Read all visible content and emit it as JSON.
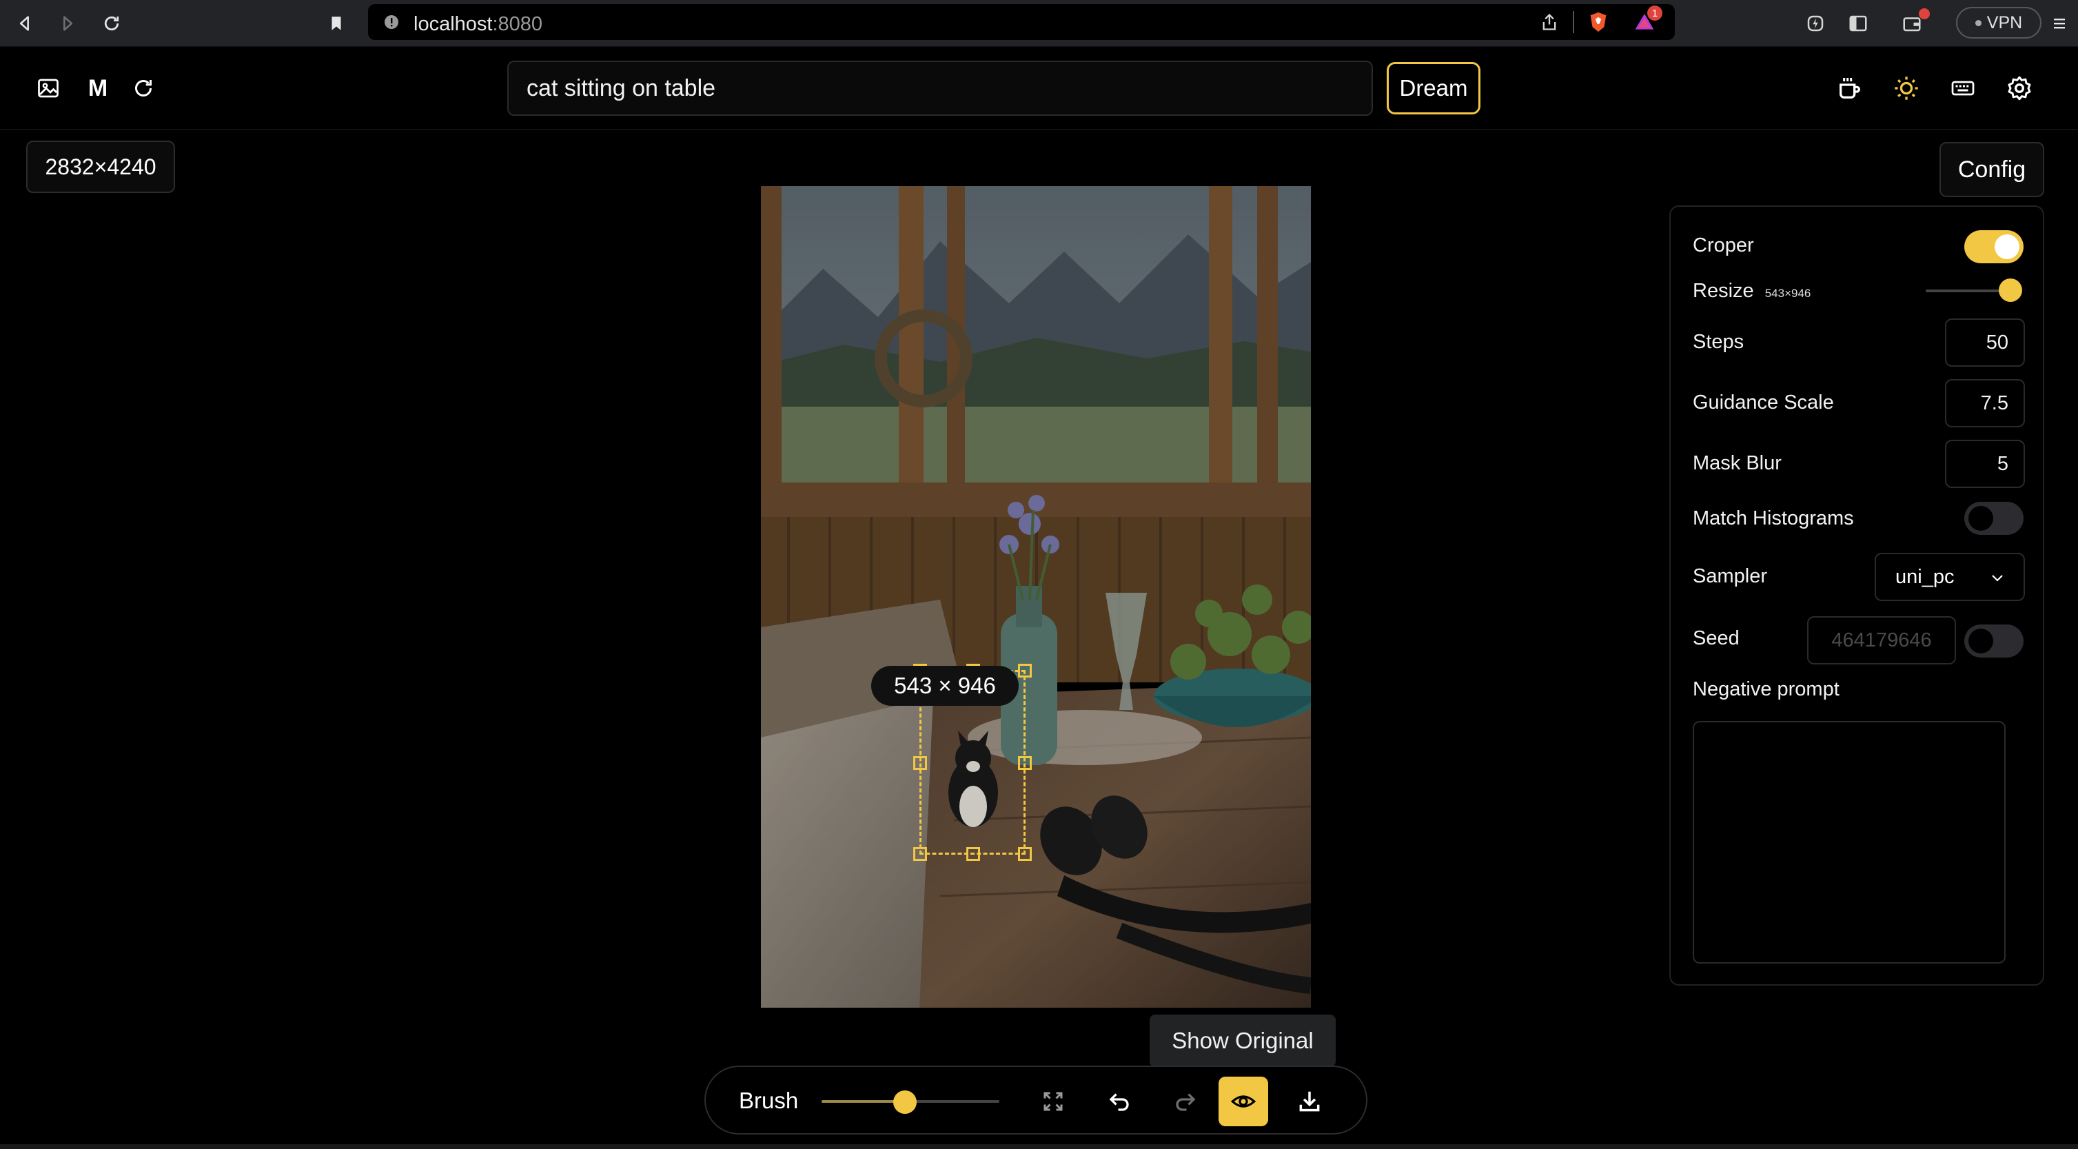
{
  "browser": {
    "url_host": "localhost",
    "url_port": ":8080",
    "vpn_label": "VPN",
    "brave_alert_count": "1"
  },
  "header": {
    "logo_text": "M",
    "prompt_value": "cat sitting on table",
    "dream_label": "Dream"
  },
  "canvas": {
    "image_dimensions": "2832×4240",
    "crop_label": "543 × 946"
  },
  "config": {
    "button_label": "Config",
    "croper_label": "Croper",
    "croper_on": true,
    "resize_label": "Resize",
    "resize_value": "543×946",
    "resize_level": 1.0,
    "steps_label": "Steps",
    "steps_value": "50",
    "guidance_label": "Guidance Scale",
    "guidance_value": "7.5",
    "mask_blur_label": "Mask Blur",
    "mask_blur_value": "5",
    "match_hist_label": "Match Histograms",
    "match_hist_on": false,
    "sampler_label": "Sampler",
    "sampler_value": "uni_pc",
    "seed_label": "Seed",
    "seed_placeholder": "464179646",
    "seed_fixed": false,
    "negative_prompt_label": "Negative prompt",
    "negative_prompt_value": ""
  },
  "toolbar": {
    "brush_label": "Brush",
    "brush_level": 0.48,
    "tooltip": "Show Original"
  },
  "colors": {
    "accent": "#f2c744",
    "background": "#000000",
    "browser_chrome": "#232428"
  }
}
